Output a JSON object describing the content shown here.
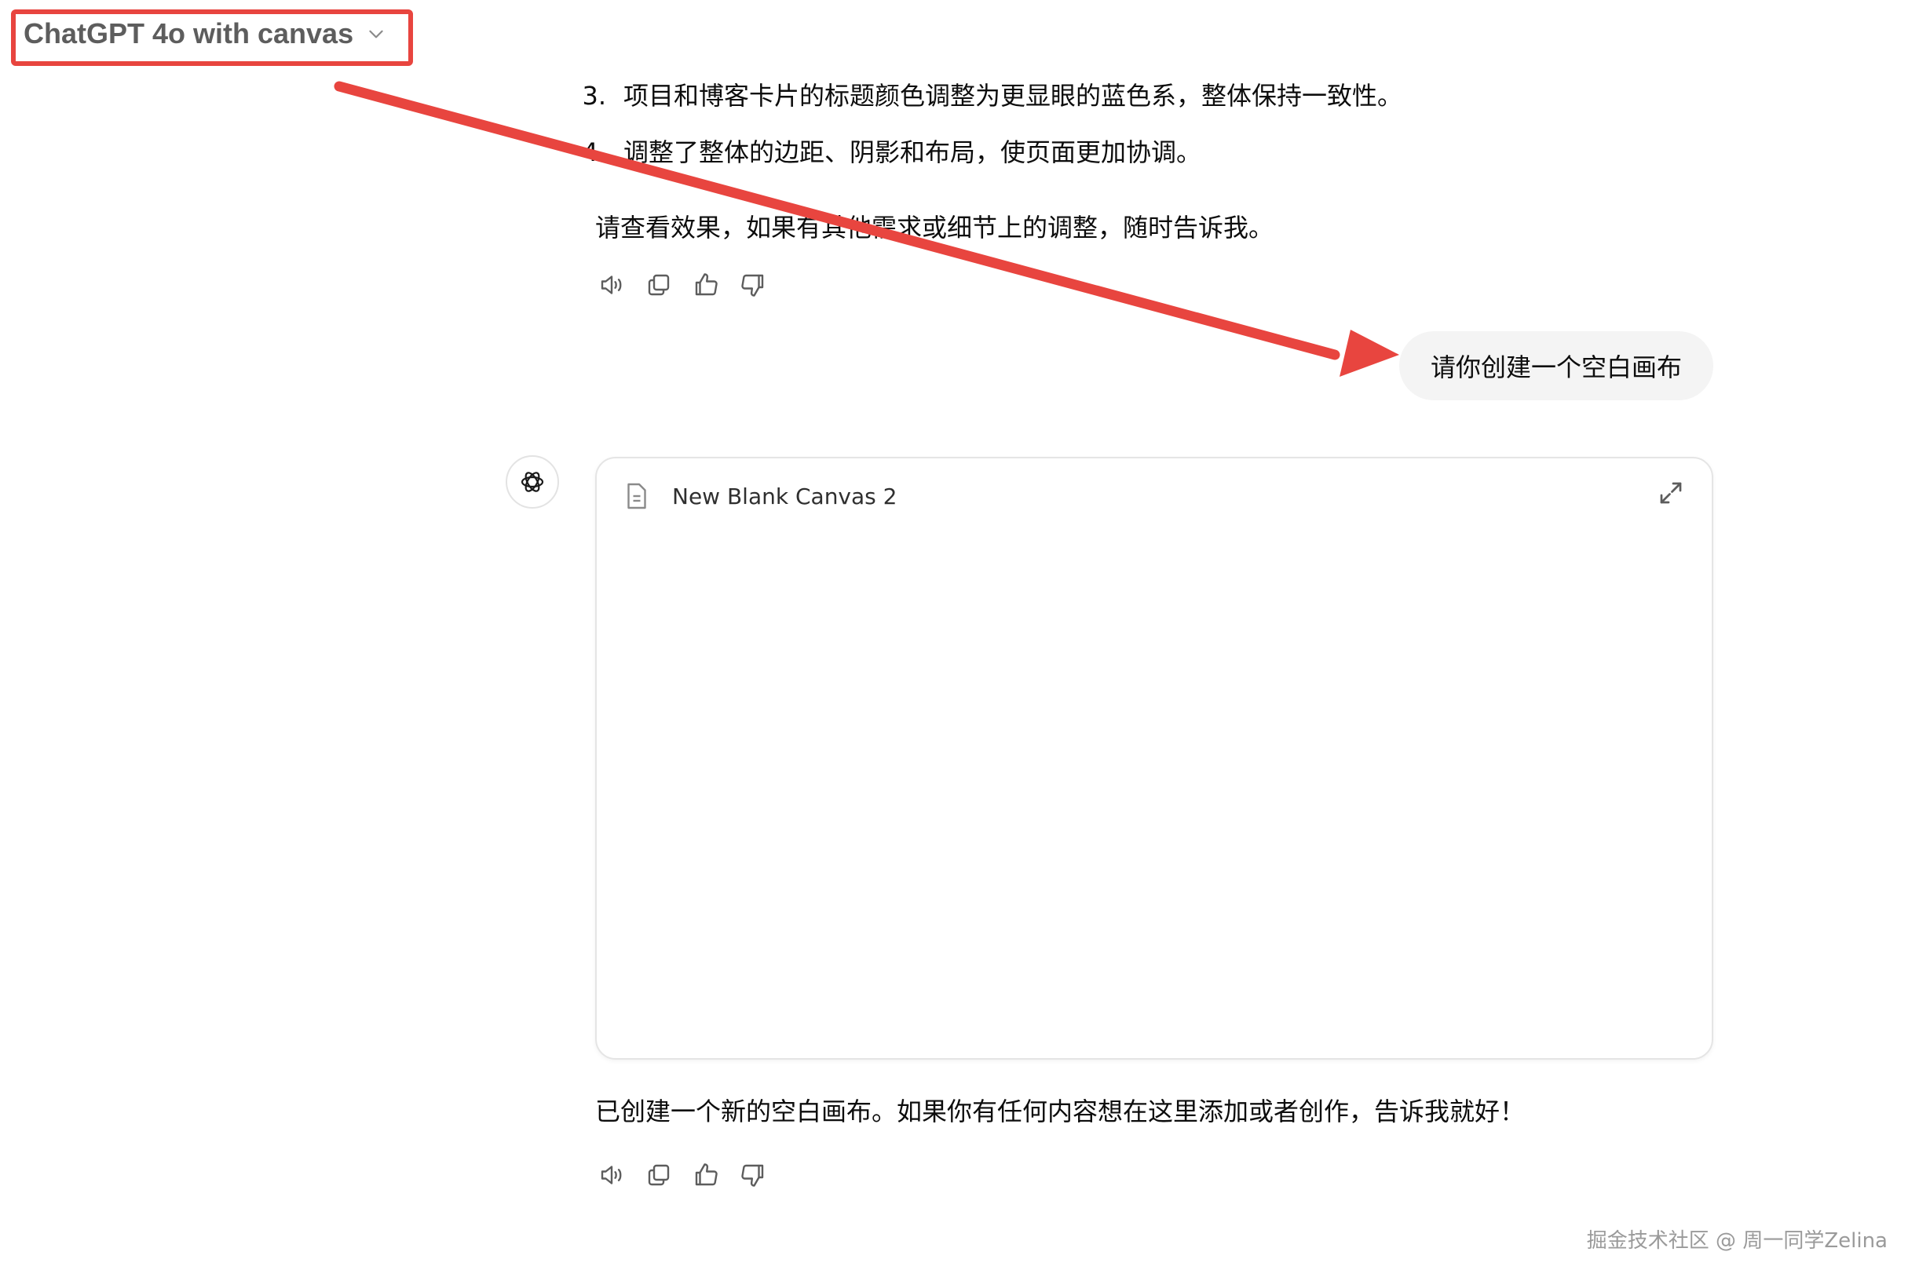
{
  "header": {
    "model_name": "ChatGPT 4o with canvas",
    "dropdown_icon": "chevron-down-icon"
  },
  "assistant_prev": {
    "list": [
      {
        "num": "3.",
        "text": "项目和博客卡片的标题颜色调整为更显眼的蓝色系，整体保持一致性。"
      },
      {
        "num": "4.",
        "text": "调整了整体的边距、阴影和布局，使页面更加协调。"
      }
    ],
    "closing": "请查看效果，如果有其他需求或细节上的调整，随时告诉我。"
  },
  "user_message": "请你创建一个空白画布",
  "canvas": {
    "title": "New Blank Canvas 2",
    "icon": "document-icon",
    "expand_icon": "expand-icon"
  },
  "assistant_reply": "已创建一个新的空白画布。如果你有任何内容想在这里添加或者创作，告诉我就好！",
  "actions": [
    "read-aloud-icon",
    "copy-icon",
    "thumbs-up-icon",
    "thumbs-down-icon"
  ],
  "watermark": "掘金技术社区 @ 周一同学Zelina",
  "annotation": {
    "color": "#e8453f"
  }
}
